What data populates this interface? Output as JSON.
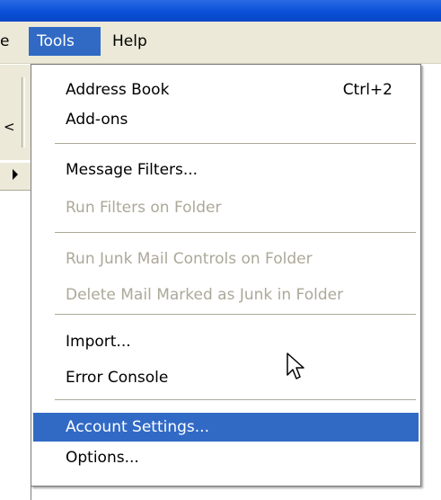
{
  "menubar": {
    "partial_item": "e",
    "tools_label": "Tools",
    "help_label": "Help"
  },
  "background": {
    "toolbar_glyph": "<"
  },
  "tools_menu": {
    "address_book": {
      "label": "Address Book",
      "shortcut": "Ctrl+2"
    },
    "add_ons": {
      "label": "Add-ons"
    },
    "message_filters": {
      "label": "Message Filters..."
    },
    "run_filters_on_folder": {
      "label": "Run Filters on Folder",
      "disabled": true
    },
    "run_junk_mail_controls": {
      "label": "Run Junk Mail Controls on Folder",
      "disabled": true
    },
    "delete_junk_mail": {
      "label": "Delete Mail Marked as Junk in Folder",
      "disabled": true
    },
    "import": {
      "label": "Import..."
    },
    "error_console": {
      "label": "Error Console"
    },
    "account_settings": {
      "label": "Account Settings...",
      "selected": true
    },
    "options": {
      "label": "Options..."
    }
  },
  "colors": {
    "titlebar_blue": "#0a50d8",
    "menubar_bg": "#ece9d8",
    "highlight": "#316ac5",
    "disabled_text": "#aca899"
  },
  "icons": {
    "cursor": "arrow-pointer-icon",
    "folder_pane_arrow": "triangle-right-icon"
  }
}
